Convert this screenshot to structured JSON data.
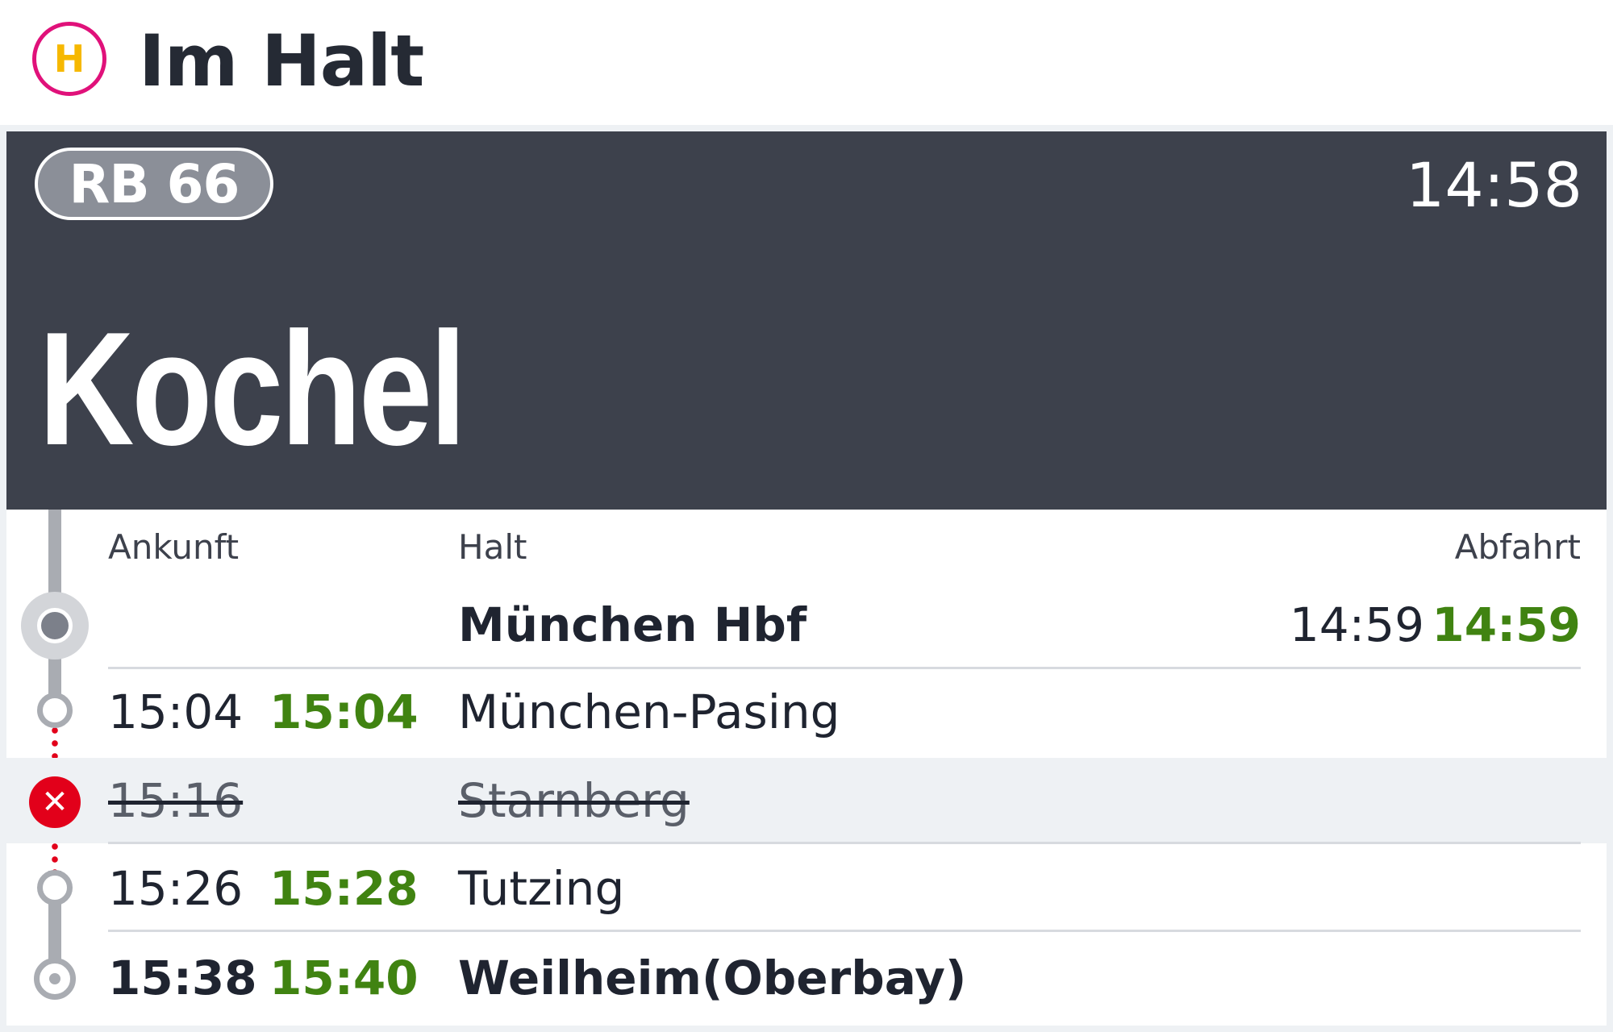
{
  "header": {
    "icon_letter": "H",
    "title": "Im Halt"
  },
  "banner": {
    "line": "RB 66",
    "time": "14:58",
    "destination": "Kochel"
  },
  "columns": {
    "arrival": "Ankunft",
    "stop": "Halt",
    "departure": "Abfahrt"
  },
  "stops": [
    {
      "name": "München Hbf",
      "arr_plan": "",
      "arr_real": "",
      "dep_plan": "14:59",
      "dep_real": "14:59",
      "cancelled": false,
      "current": true
    },
    {
      "name": "München-Pasing",
      "arr_plan": "15:04",
      "arr_real": "15:04",
      "dep_plan": "",
      "dep_real": "",
      "cancelled": false
    },
    {
      "name": "Starnberg",
      "arr_plan": "15:16",
      "arr_real": "",
      "dep_plan": "",
      "dep_real": "",
      "cancelled": true,
      "status_icon": "cancel-x-icon"
    },
    {
      "name": "Tutzing",
      "arr_plan": "15:26",
      "arr_real": "15:28",
      "dep_plan": "",
      "dep_real": "",
      "cancelled": false
    },
    {
      "name": "Weilheim(Oberbay)",
      "arr_plan": "15:38",
      "arr_real": "15:40",
      "dep_plan": "",
      "dep_real": "",
      "cancelled": false,
      "final": true
    }
  ],
  "colors": {
    "banner_bg": "#3d414c",
    "on_time_green": "#408311",
    "cancel_red": "#e2001a",
    "halt_ring_magenta": "#e0117a",
    "halt_letter_yellow": "#f6b800"
  }
}
